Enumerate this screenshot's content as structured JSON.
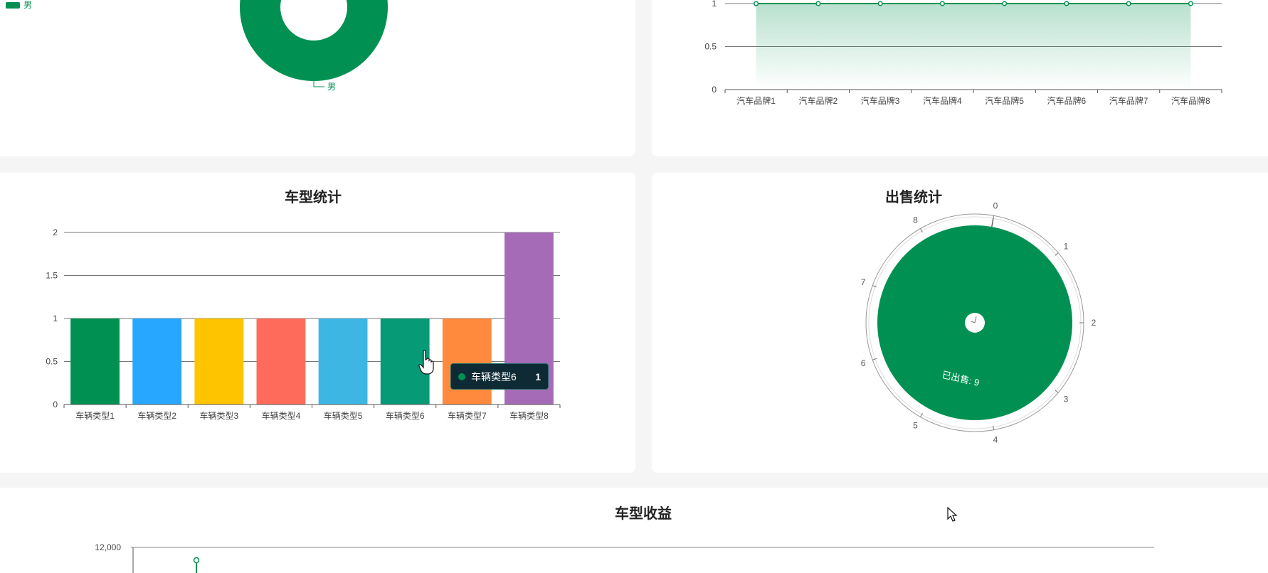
{
  "colors": {
    "primary": "#009152",
    "panel": "#ffffff",
    "background": "#f5f5f5",
    "tooltip_bg": "#0e2a35"
  },
  "gender_panel": {
    "legend_label": "男",
    "slice_label": "男",
    "chart_data": {
      "type": "pie",
      "categories": [
        "男"
      ],
      "values": [
        1
      ]
    }
  },
  "brand_panel": {
    "chart_data": {
      "type": "area",
      "categories": [
        "汽车品牌1",
        "汽车品牌2",
        "汽车品牌3",
        "汽车品牌4",
        "汽车品牌5",
        "汽车品牌6",
        "汽车品牌7",
        "汽车品牌8"
      ],
      "values": [
        1,
        1,
        1,
        1,
        1,
        1,
        1,
        1
      ],
      "y_ticks": [
        "0",
        "0.5",
        "1"
      ],
      "ylim": [
        0,
        1
      ],
      "grid": true
    }
  },
  "vehicle_type_panel": {
    "title": "车型统计",
    "chart_data": {
      "type": "bar",
      "categories": [
        "车辆类型1",
        "车辆类型2",
        "车辆类型3",
        "车辆类型4",
        "车辆类型5",
        "车辆类型6",
        "车辆类型7",
        "车辆类型8"
      ],
      "values": [
        1,
        1,
        1,
        1,
        1,
        1,
        1,
        2
      ],
      "colors": [
        "#009152",
        "#27a7ff",
        "#ffc400",
        "#ff6b5a",
        "#3db6e3",
        "#079a77",
        "#ff8a3d",
        "#a66bb6"
      ],
      "y_ticks": [
        "0",
        "0.5",
        "1",
        "1.5",
        "2"
      ],
      "ylim": [
        0,
        2
      ],
      "grid": true
    },
    "tooltip": {
      "name": "车辆类型6",
      "value": "1"
    }
  },
  "sales_panel": {
    "title": "出售统计",
    "chart_data": {
      "type": "pie",
      "categories": [
        "已出售"
      ],
      "values": [
        9
      ],
      "label": "已出售: 9",
      "angle_ticks": [
        "0",
        "1",
        "2",
        "3",
        "4",
        "5",
        "6",
        "7",
        "8"
      ]
    }
  },
  "revenue_panel": {
    "title": "车型收益",
    "y_tick_top": "12,000"
  }
}
